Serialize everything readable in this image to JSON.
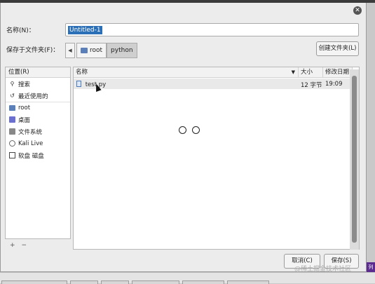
{
  "dialog": {
    "name_label": "名称(N)：",
    "filename": "Untitled-1",
    "folder_label": "保存于文件夹(F)：",
    "path_segments": [
      "root",
      "python"
    ],
    "create_folder": "创建文件夹(L)",
    "cancel": "取消(C)",
    "save": "保存(S)"
  },
  "places": {
    "header": "位置(R)",
    "items": [
      {
        "label": "搜索",
        "icon": "search-icon"
      },
      {
        "label": "最近使用的",
        "icon": "recent-icon"
      },
      {
        "label": "root",
        "icon": "home-folder-icon"
      },
      {
        "label": "桌面",
        "icon": "desktop-icon"
      },
      {
        "label": "文件系统",
        "icon": "filesystem-icon"
      },
      {
        "label": "Kali Live",
        "icon": "cd-icon"
      },
      {
        "label": "软盘 磁盘",
        "icon": "floppy-icon"
      }
    ],
    "add": "+",
    "remove": "−"
  },
  "files": {
    "columns": {
      "name": "名称",
      "size": "大小",
      "modified": "修改日期"
    },
    "rows": [
      {
        "name": "test.py",
        "size": "12 字节",
        "modified": "19:09"
      }
    ]
  },
  "watermark": "@稀土掘金技术社区",
  "side_tab": "列"
}
